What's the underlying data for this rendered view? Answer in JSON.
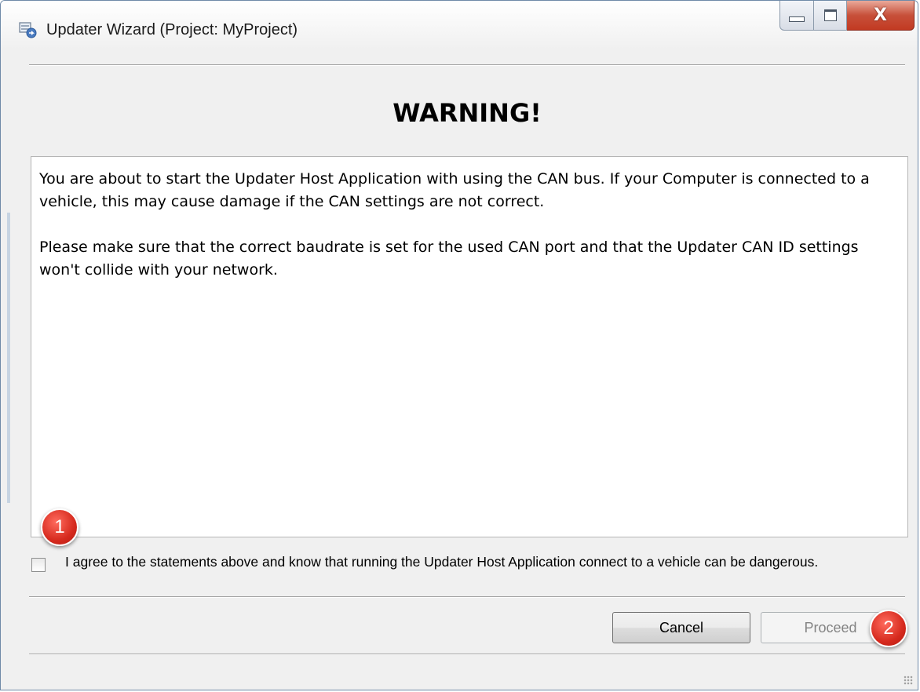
{
  "window": {
    "title": "Updater Wizard (Project: MyProject)",
    "close_glyph": "X"
  },
  "dialog": {
    "heading": "WARNING!",
    "paragraph1": "You are about to start the Updater Host Application with using the CAN bus. If your Computer is connected to a vehicle, this may cause damage if the CAN settings are not correct.",
    "paragraph2": "Please make sure that the correct baudrate is set for the used CAN port and that the Updater CAN ID settings won't collide with your network."
  },
  "agreement": {
    "checked": false,
    "label": "I agree to the statements above and know that running the Updater Host Application connect to a vehicle can be dangerous."
  },
  "buttons": {
    "cancel": "Cancel",
    "proceed": "Proceed",
    "proceed_enabled": false
  },
  "annotations": {
    "badge1": "1",
    "badge2": "2",
    "color": "#d62a1e"
  },
  "icons": {
    "app": "updater-app-icon",
    "minimize": "minimize-icon",
    "maximize": "maximize-icon",
    "close": "close-icon"
  }
}
